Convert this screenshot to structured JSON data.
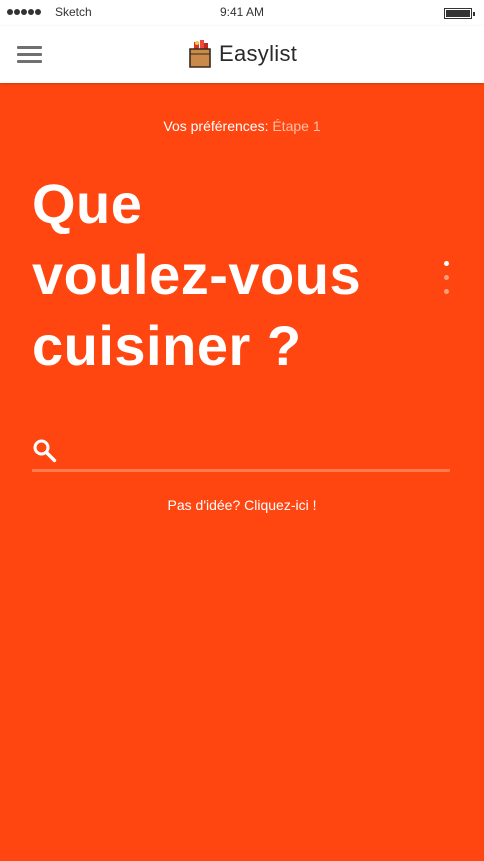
{
  "status_bar": {
    "carrier": "Sketch",
    "time": "9:41 AM"
  },
  "nav": {
    "menu_icon": "hamburger-menu-icon",
    "logo_icon": "grocery-bag-icon",
    "brand_name": "Easylist"
  },
  "preferences": {
    "label": "Vos préférences:",
    "step": "Étape 1"
  },
  "headline": {
    "line1": "Que",
    "line2": "voulez-vous",
    "line3": "cuisiner ?"
  },
  "steps": {
    "total": 3,
    "current": 1
  },
  "search": {
    "icon": "search-icon",
    "value": "",
    "placeholder": ""
  },
  "hint": {
    "label": "Pas d'idée? Cliquez-ici !"
  },
  "colors": {
    "background": "#ff4611",
    "accent_light": "#ffbfa7",
    "underline": "#ff7b4f",
    "text": "#ffffff"
  }
}
